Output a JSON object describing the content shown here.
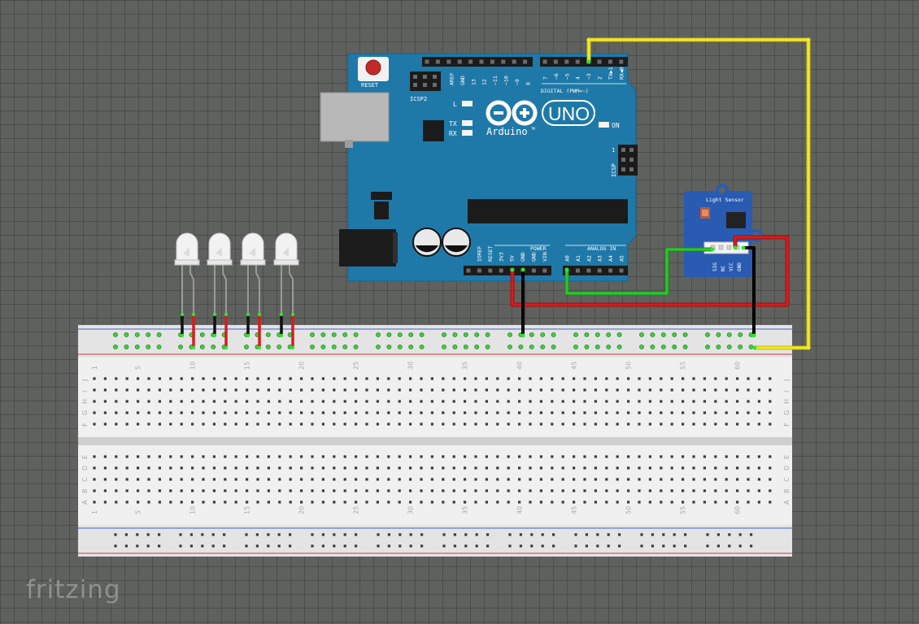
{
  "app": {
    "brand": "fritzing"
  },
  "colors": {
    "canvas": "#5f615e",
    "arduino_board": "#1f79a8",
    "sensor_board": "#2a5bb2",
    "wire_power": "#d81c1c",
    "wire_ground": "#1a1a1a",
    "wire_signal": "#2fc52f",
    "wire_digital": "#f2e828",
    "breadboard": "#e4e4e4",
    "rail_positive": "#d23b3b",
    "rail_negative": "#3b5fd2"
  },
  "arduino": {
    "reset_label": "RESET",
    "icsp2_label": "ICSP2",
    "icsp_label": "ICSP",
    "icsp_pin_label": "1",
    "logo_text": "Arduino",
    "tm": "TM",
    "uno_text": "UNO",
    "on_label": "ON",
    "l_label": "L",
    "tx_label": "TX",
    "rx_label": "RX",
    "digital_label": "DIGITAL (PWM=~)",
    "analog_label": "ANALOG IN",
    "power_label": "POWER",
    "top_left_pins": [
      "AREF",
      "GND",
      "13",
      "12",
      "~11",
      "~10",
      "~9",
      "8"
    ],
    "top_right_pins": [
      "7",
      "~6",
      "~5",
      "4",
      "~3",
      "2",
      "TX▶1",
      "RX◀0"
    ],
    "power_pins": [
      "IOREF",
      "RESET",
      "3V3",
      "5V",
      "GND",
      "GND",
      "VIN"
    ],
    "analog_pins": [
      "A0",
      "A1",
      "A2",
      "A3",
      "A4",
      "A5"
    ]
  },
  "sensor": {
    "title": "Light Sensor",
    "pins": [
      "SIG",
      "NC",
      "VCC",
      "GND"
    ]
  },
  "leds": {
    "count": 4,
    "color": "white"
  },
  "breadboard": {
    "columns": 63,
    "top_rows": [
      "J",
      "I",
      "H",
      "G",
      "F"
    ],
    "bottom_rows": [
      "E",
      "D",
      "C",
      "B",
      "A"
    ],
    "column_labels": [
      "1",
      "5",
      "10",
      "15",
      "20",
      "25",
      "30",
      "35",
      "40",
      "45",
      "50",
      "55",
      "60"
    ]
  },
  "wires": [
    {
      "name": "wire-5v",
      "color": "red",
      "from": "Arduino 5V",
      "to": "Light Sensor VCC"
    },
    {
      "name": "wire-gnd-arduino",
      "color": "black",
      "from": "Arduino GND",
      "to": "breadboard ground rail"
    },
    {
      "name": "wire-a0",
      "color": "green",
      "from": "Arduino A0",
      "to": "Light Sensor SIG"
    },
    {
      "name": "wire-pin3",
      "color": "yellow",
      "from": "Arduino ~3",
      "to": "breadboard rail"
    },
    {
      "name": "wire-sensor-gnd",
      "color": "black",
      "from": "Light Sensor GND",
      "to": "breadboard ground rail"
    }
  ]
}
